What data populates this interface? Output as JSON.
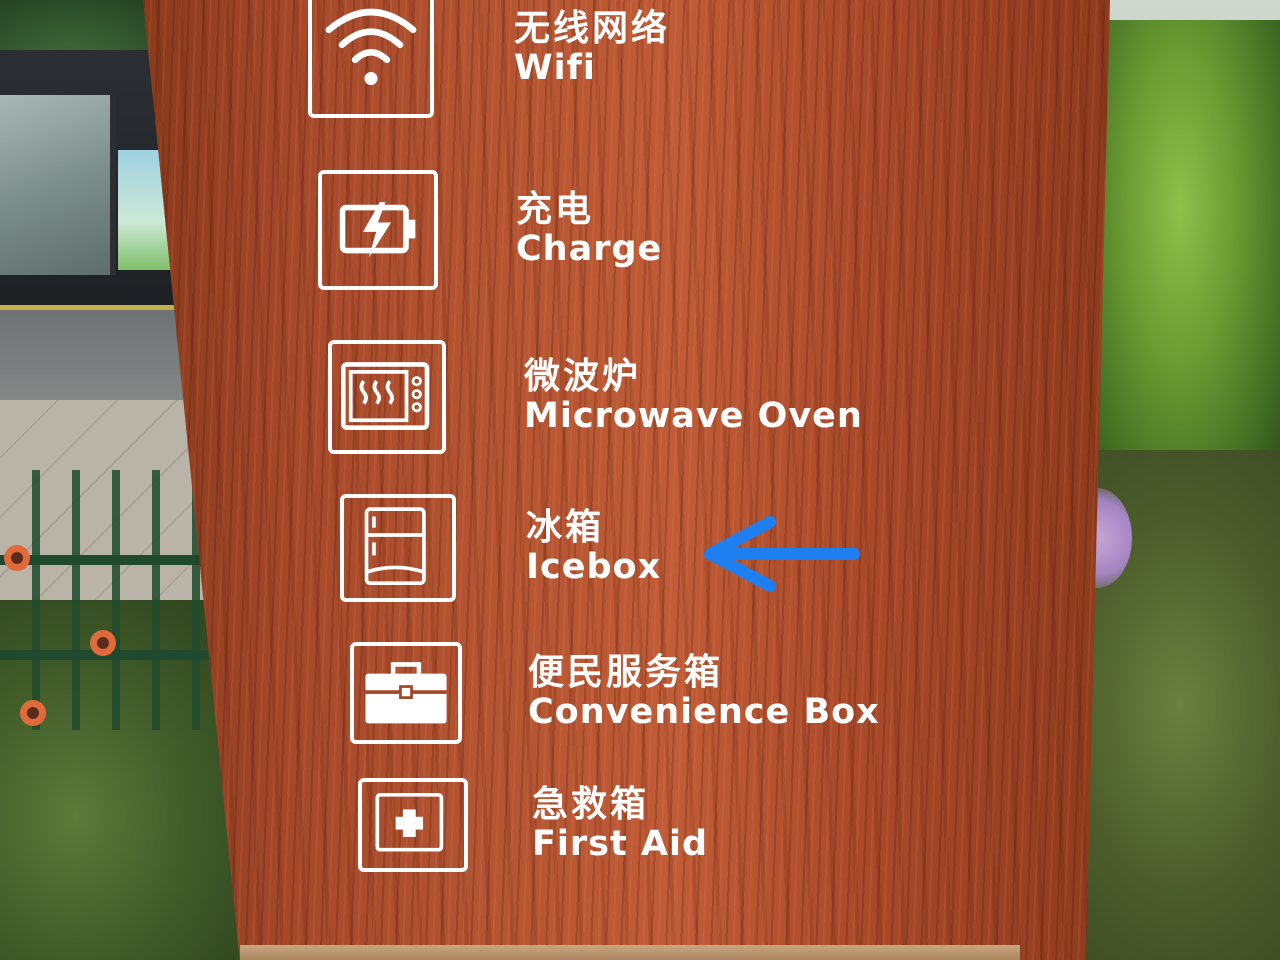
{
  "sign": {
    "items": [
      {
        "icon": "wifi-icon",
        "zh": "无线网络",
        "en": "Wifi"
      },
      {
        "icon": "charge-icon",
        "zh": "充电",
        "en": "Charge"
      },
      {
        "icon": "microwave-icon",
        "zh": "微波炉",
        "en": "Microwave Oven"
      },
      {
        "icon": "icebox-icon",
        "zh": "冰箱",
        "en": "Icebox"
      },
      {
        "icon": "toolbox-icon",
        "zh": "便民服务箱",
        "en": "Convenience Box"
      },
      {
        "icon": "first-aid-icon",
        "zh": "急救箱",
        "en": "First Aid"
      }
    ]
  },
  "colors": {
    "wood": "#b45432",
    "sign_text": "#ffffff",
    "arrow": "#1e7ff0"
  }
}
